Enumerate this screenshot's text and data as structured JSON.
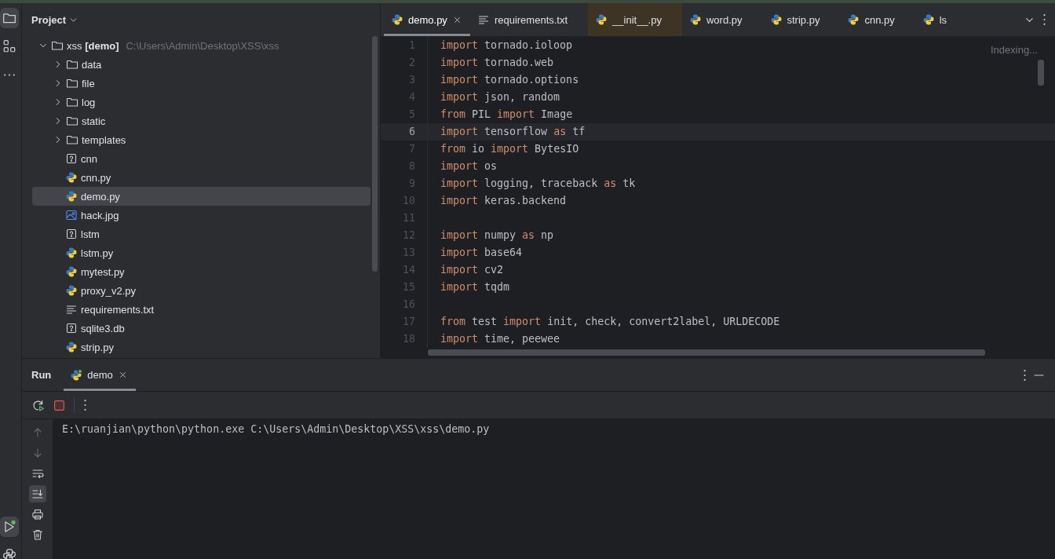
{
  "left_toolbar": {
    "top": [
      {
        "kind": "folder",
        "selected": true
      },
      {
        "kind": "structure",
        "selected": false
      },
      {
        "kind": "more",
        "selected": false
      }
    ],
    "bottom": [
      {
        "kind": "run",
        "selected": true
      },
      {
        "kind": "python",
        "selected": false
      }
    ]
  },
  "project": {
    "title": "Project",
    "tree": [
      {
        "label": "xss **[demo]**",
        "path": "C:\\Users\\Admin\\Desktop\\XSS\\xss",
        "kind": "folder",
        "expanded": true,
        "selected": false,
        "children": [
          {
            "label": "data",
            "kind": "folder",
            "expanded": false,
            "selected": false
          },
          {
            "label": "file",
            "kind": "folder",
            "expanded": false,
            "selected": false
          },
          {
            "label": "log",
            "kind": "folder",
            "expanded": false,
            "selected": false
          },
          {
            "label": "static",
            "kind": "folder",
            "expanded": false,
            "selected": false
          },
          {
            "label": "templates",
            "kind": "folder",
            "expanded": false,
            "selected": false
          },
          {
            "label": "cnn",
            "kind": "unknown",
            "selected": false
          },
          {
            "label": "cnn.py",
            "kind": "python",
            "selected": false
          },
          {
            "label": "demo.py",
            "kind": "python",
            "selected": true
          },
          {
            "label": "hack.jpg",
            "kind": "image",
            "selected": false
          },
          {
            "label": "lstm",
            "kind": "unknown",
            "selected": false
          },
          {
            "label": "lstm.py",
            "kind": "python",
            "selected": false
          },
          {
            "label": "mytest.py",
            "kind": "python",
            "selected": false
          },
          {
            "label": "proxy_v2.py",
            "kind": "python",
            "selected": false
          },
          {
            "label": "requirements.txt",
            "kind": "text",
            "selected": false
          },
          {
            "label": "sqlite3.db",
            "kind": "unknown",
            "selected": false
          },
          {
            "label": "strip.py",
            "kind": "python",
            "selected": false
          }
        ]
      }
    ]
  },
  "editor": {
    "tabs": [
      {
        "label": "demo.py",
        "kind": "python",
        "selected": true,
        "highlighted": false
      },
      {
        "label": "requirements.txt",
        "kind": "text",
        "selected": false,
        "highlighted": false
      },
      {
        "label": "__init__.py",
        "kind": "python",
        "selected": false,
        "highlighted": true
      },
      {
        "label": "word.py",
        "kind": "python",
        "selected": false,
        "highlighted": false
      },
      {
        "label": "strip.py",
        "kind": "python",
        "selected": false,
        "highlighted": false
      },
      {
        "label": "cnn.py",
        "kind": "python",
        "selected": false,
        "highlighted": false
      },
      {
        "label": "ls",
        "kind": "python",
        "selected": false,
        "highlighted": false
      }
    ],
    "status": "Indexing...",
    "lines": [
      {
        "number": "1",
        "current": false,
        "tokens": [
          {
            "kind": "keyword",
            "text": "import"
          },
          {
            "kind": "plain",
            "text": " tornado.ioloop"
          }
        ]
      },
      {
        "number": "2",
        "current": false,
        "tokens": [
          {
            "kind": "keyword",
            "text": "import"
          },
          {
            "kind": "plain",
            "text": " tornado.web"
          }
        ]
      },
      {
        "number": "3",
        "current": false,
        "tokens": [
          {
            "kind": "keyword",
            "text": "import"
          },
          {
            "kind": "plain",
            "text": " tornado.options"
          }
        ]
      },
      {
        "number": "4",
        "current": false,
        "tokens": [
          {
            "kind": "keyword",
            "text": "import"
          },
          {
            "kind": "plain",
            "text": " json, random"
          }
        ]
      },
      {
        "number": "5",
        "current": false,
        "tokens": [
          {
            "kind": "keyword",
            "text": "from"
          },
          {
            "kind": "plain",
            "text": " PIL "
          },
          {
            "kind": "keyword",
            "text": "import"
          },
          {
            "kind": "plain",
            "text": " Image"
          }
        ]
      },
      {
        "number": "6",
        "current": true,
        "tokens": [
          {
            "kind": "keyword",
            "text": "import"
          },
          {
            "kind": "plain",
            "text": " tensorflow "
          },
          {
            "kind": "keyword",
            "text": "as"
          },
          {
            "kind": "plain",
            "text": " tf"
          }
        ]
      },
      {
        "number": "7",
        "current": false,
        "tokens": [
          {
            "kind": "keyword",
            "text": "from"
          },
          {
            "kind": "plain",
            "text": " io "
          },
          {
            "kind": "keyword",
            "text": "import"
          },
          {
            "kind": "plain",
            "text": " BytesIO"
          }
        ]
      },
      {
        "number": "8",
        "current": false,
        "tokens": [
          {
            "kind": "keyword",
            "text": "import"
          },
          {
            "kind": "plain",
            "text": " os"
          }
        ]
      },
      {
        "number": "9",
        "current": false,
        "tokens": [
          {
            "kind": "keyword",
            "text": "import"
          },
          {
            "kind": "plain",
            "text": " logging, traceback "
          },
          {
            "kind": "keyword",
            "text": "as"
          },
          {
            "kind": "plain",
            "text": " tk"
          }
        ]
      },
      {
        "number": "10",
        "current": false,
        "tokens": [
          {
            "kind": "keyword",
            "text": "import"
          },
          {
            "kind": "plain",
            "text": " keras.backend"
          }
        ]
      },
      {
        "number": "11",
        "current": false
      },
      {
        "number": "12",
        "current": false,
        "tokens": [
          {
            "kind": "keyword",
            "text": "import"
          },
          {
            "kind": "plain",
            "text": " numpy "
          },
          {
            "kind": "keyword",
            "text": "as"
          },
          {
            "kind": "plain",
            "text": " np"
          }
        ]
      },
      {
        "number": "13",
        "current": false,
        "tokens": [
          {
            "kind": "keyword",
            "text": "import"
          },
          {
            "kind": "plain",
            "text": " base64"
          }
        ]
      },
      {
        "number": "14",
        "current": false,
        "tokens": [
          {
            "kind": "keyword",
            "text": "import"
          },
          {
            "kind": "plain",
            "text": " cv2"
          }
        ]
      },
      {
        "number": "15",
        "current": false,
        "tokens": [
          {
            "kind": "keyword",
            "text": "import"
          },
          {
            "kind": "plain",
            "text": " tqdm"
          }
        ]
      },
      {
        "number": "16",
        "current": false
      },
      {
        "number": "17",
        "current": false,
        "tokens": [
          {
            "kind": "keyword",
            "text": "from"
          },
          {
            "kind": "plain",
            "text": " test "
          },
          {
            "kind": "keyword",
            "text": "import"
          },
          {
            "kind": "plain",
            "text": " init, check, convert2label, URLDECODE"
          }
        ]
      },
      {
        "number": "18",
        "current": false,
        "tokens": [
          {
            "kind": "keyword",
            "text": "import"
          },
          {
            "kind": "plain",
            "text": " time, peewee"
          }
        ]
      }
    ]
  },
  "run": {
    "title": "Run",
    "tabs": [
      {
        "label": "demo",
        "selected": true
      }
    ],
    "toolbar": [
      {
        "kind": "rerun"
      },
      {
        "kind": "stop"
      },
      {
        "kind": "more"
      }
    ],
    "side_tools": [
      {
        "kind": "up",
        "disabled": true,
        "on": false
      },
      {
        "kind": "down",
        "disabled": true,
        "on": false
      },
      {
        "kind": "wrap",
        "disabled": false,
        "on": false
      },
      {
        "kind": "scroll-end",
        "disabled": false,
        "on": true
      },
      {
        "kind": "print",
        "disabled": false,
        "on": false
      },
      {
        "kind": "trash",
        "disabled": false,
        "on": false
      }
    ],
    "output": [
      "E:\\ruanjian\\python\\python.exe C:\\Users\\Admin\\Desktop\\XSS\\xss\\demo.py"
    ]
  }
}
